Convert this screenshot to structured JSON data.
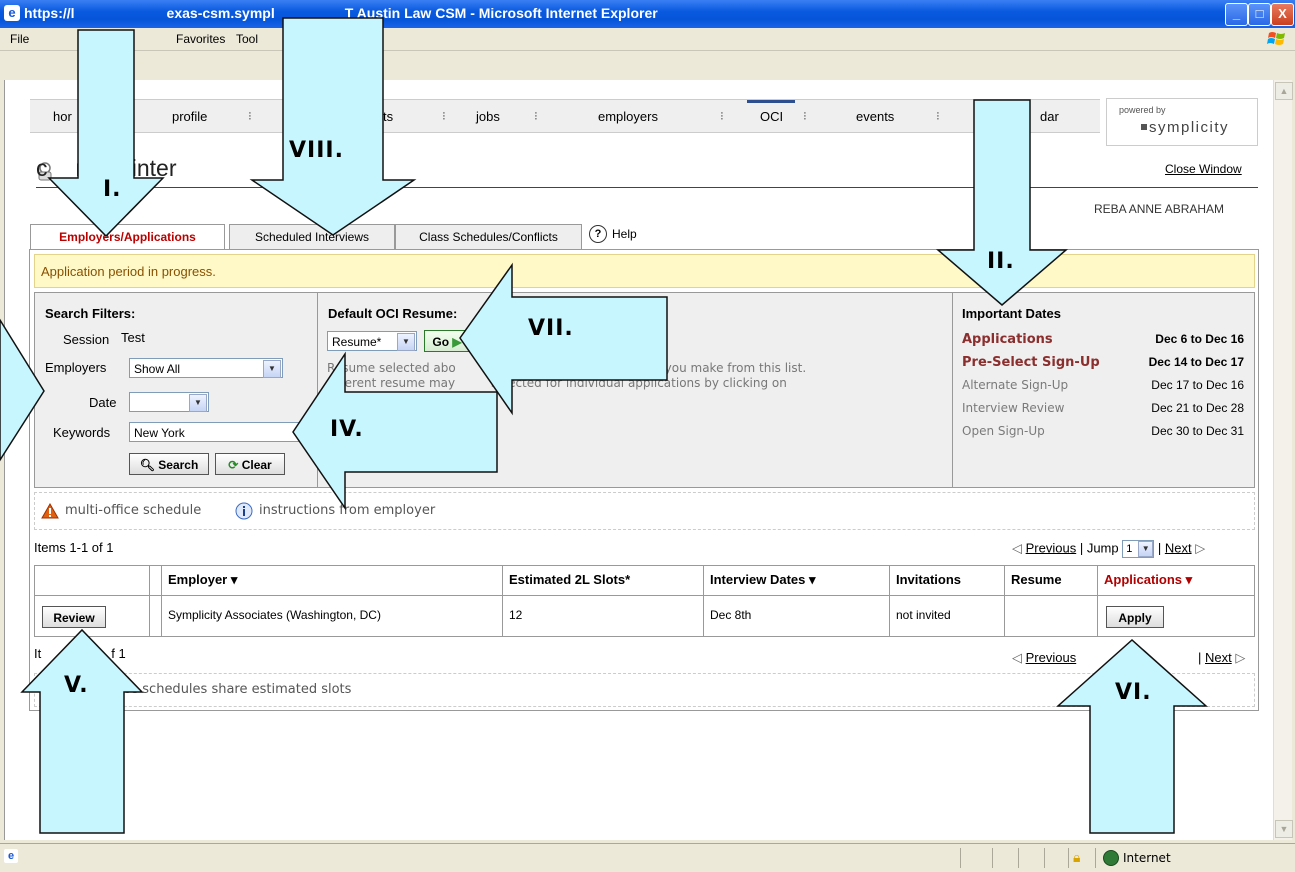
{
  "window": {
    "title": "https://lawutexas-csm.symplicity.com - UT Austin Law CSM - Microsoft Internet Explorer",
    "title_visible_left": "https://l",
    "title_visible_mid": "exas-csm.sympl",
    "title_visible_right": "T Austin Law CSM - Microsoft Internet Explorer",
    "min": "_",
    "max": "□",
    "close": "X"
  },
  "menu": {
    "file": "File",
    "favorites": "Favorites",
    "tools": "Tool"
  },
  "nav": {
    "home": "hor",
    "profile": "profile",
    "documents": "ts",
    "jobs": "jobs",
    "employers": "employers",
    "oci": "OCI",
    "events": "events",
    "calendar": "dar"
  },
  "powered": {
    "line1": "powered by",
    "line2": "symplicity"
  },
  "page": {
    "title_left": "c",
    "title_right": "npus inter",
    "close_window": "Close Window",
    "user": "REBA ANNE ABRAHAM"
  },
  "tabs": {
    "employers_applications": "Employers/Applications",
    "scheduled_interviews": "Scheduled Interviews",
    "class_schedules": "Class Schedules/Conflicts",
    "help": "Help"
  },
  "banner": "Application period in progress.",
  "filters": {
    "heading": "Search Filters:",
    "session_label": "Session",
    "session_value": "Test",
    "employers_label": "Employers",
    "employers_value": "Show All",
    "date_label": "Date",
    "date_value": "",
    "keywords_label": "Keywords",
    "keywords_value": "New York",
    "search": "Search",
    "clear": "Clear"
  },
  "resume": {
    "heading": "Default OCI Resume:",
    "select_value": "Resume*",
    "go": "Go",
    "desc1a": "R",
    "desc1b": "esume selected abo",
    "desc1c": "pplications you make from this list.",
    "desc2a": "ifferent resume may",
    "desc2b": "selected for individual applications by clicking on"
  },
  "dates": {
    "heading": "Important Dates",
    "rows": [
      {
        "label": "Applications",
        "value": "Dec 6 to Dec 16",
        "style": "bold-red"
      },
      {
        "label": "Pre-Select Sign-Up",
        "value": "Dec 14 to Dec 17",
        "style": "bold-red"
      },
      {
        "label": "Alternate Sign-Up",
        "value": "Dec 17 to Dec 16",
        "style": "gray"
      },
      {
        "label": "Interview Review",
        "value": "Dec 21 to Dec 28",
        "style": "gray"
      },
      {
        "label": "Open Sign-Up",
        "value": "Dec 30 to Dec 31",
        "style": "gray"
      }
    ]
  },
  "legend": {
    "multi_office": "multi-office schedule",
    "instructions": "instructions from employer"
  },
  "pager_top": {
    "items": "Items 1-1 of 1",
    "previous": "Previous",
    "jump": "Jump",
    "page": "1",
    "next": "Next"
  },
  "table": {
    "headers": [
      "Employer ▾",
      "Estimated 2L Slots*",
      "Interview Dates ▾",
      "Invitations",
      "Resume",
      "Applications ▾"
    ],
    "row": {
      "review": "Review",
      "employer": "Symplicity Associates (Washington, DC)",
      "slots": "12",
      "dates": "Dec 8th",
      "invitations": "not invited",
      "resume": "",
      "apply": "Apply"
    }
  },
  "pager_bottom": {
    "items_a": "It",
    "items_b": "f 1",
    "previous": "Previous",
    "next": "Next"
  },
  "footnote": "ce schedules share estimated slots",
  "status": {
    "zone": "Internet"
  },
  "annotations": {
    "I": "I.",
    "II": "II.",
    "IV": "IV.",
    "V": "V.",
    "VI": "VI.",
    "VII": "VII.",
    "VIII": "VIII."
  },
  "colors": {
    "accent_red": "#b00000",
    "date_red": "#8b2e2e",
    "banner": "#fff9c7",
    "arrow_fill": "#c8f6ff"
  }
}
